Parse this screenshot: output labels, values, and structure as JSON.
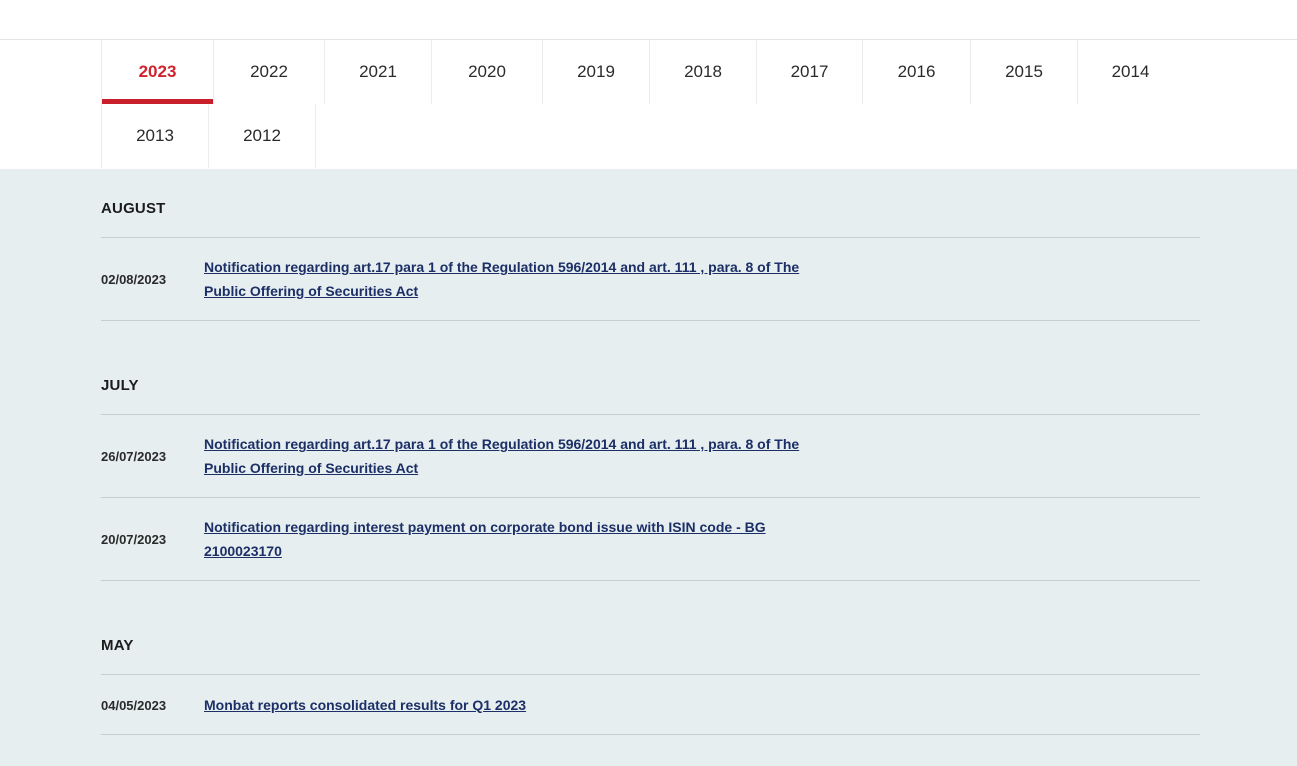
{
  "years": {
    "row1": [
      "2023",
      "2022",
      "2021",
      "2020",
      "2019",
      "2018",
      "2017",
      "2016",
      "2015",
      "2014"
    ],
    "row2": [
      "2013",
      "2012"
    ],
    "active": "2023"
  },
  "months": [
    {
      "name": "AUGUST",
      "items": [
        {
          "date": "02/08/2023",
          "title": "Notification regarding art.17 para 1 of the Regulation 596/2014 and art. 111 , para. 8 of The Public Offering of Securities Act"
        }
      ]
    },
    {
      "name": "JULY",
      "items": [
        {
          "date": "26/07/2023",
          "title": "Notification regarding art.17 para 1 of the Regulation 596/2014 and art. 111 , para. 8 of The Public Offering of Securities Act"
        },
        {
          "date": "20/07/2023",
          "title": "Notification regarding interest payment on corporate bond issue with ISIN code - BG 2100023170"
        }
      ]
    },
    {
      "name": "MAY",
      "items": [
        {
          "date": "04/05/2023",
          "title": "Monbat reports consolidated results for Q1 2023"
        }
      ]
    }
  ],
  "colors": {
    "accent": "#c81f2b",
    "link": "#1c2f66",
    "background": "#e6eef0"
  }
}
